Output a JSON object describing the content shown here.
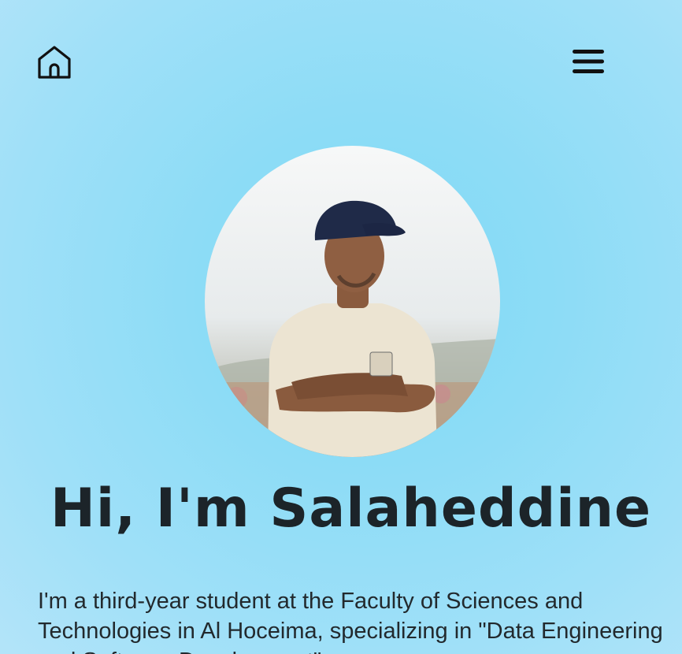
{
  "nav": {
    "home_icon": "home-icon",
    "menu_icon": "hamburger-menu-icon"
  },
  "hero": {
    "title": "Hi, I'm Salaheddine",
    "bio": "I'm a third-year student at the Faculty of Sciences and Technologies in Al Hoceima, specializing in \"Data Engineering and Software Development\"."
  },
  "colors": {
    "background": "#8ddcf6",
    "text": "#1c2429"
  }
}
